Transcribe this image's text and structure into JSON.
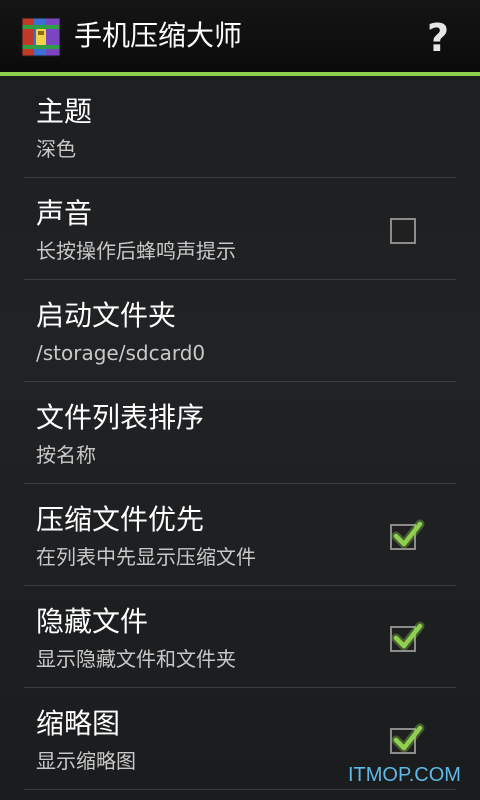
{
  "app": {
    "title": "手机压缩大师",
    "icon": "winrar-books-icon",
    "help_label": "?",
    "accent_color": "#8fd14f"
  },
  "settings": [
    {
      "title": "主题",
      "summary": "深色",
      "checkbox": null
    },
    {
      "title": "声音",
      "summary": "长按操作后蜂鸣声提示",
      "checkbox": false
    },
    {
      "title": "启动文件夹",
      "summary": "/storage/sdcard0",
      "checkbox": null
    },
    {
      "title": "文件列表排序",
      "summary": "按名称",
      "checkbox": null
    },
    {
      "title": "压缩文件优先",
      "summary": "在列表中先显示压缩文件",
      "checkbox": true
    },
    {
      "title": "隐藏文件",
      "summary": "显示隐藏文件和文件夹",
      "checkbox": true
    },
    {
      "title": "缩略图",
      "summary": "显示缩略图",
      "checkbox": true
    }
  ],
  "watermark": "ITMOP.COM"
}
